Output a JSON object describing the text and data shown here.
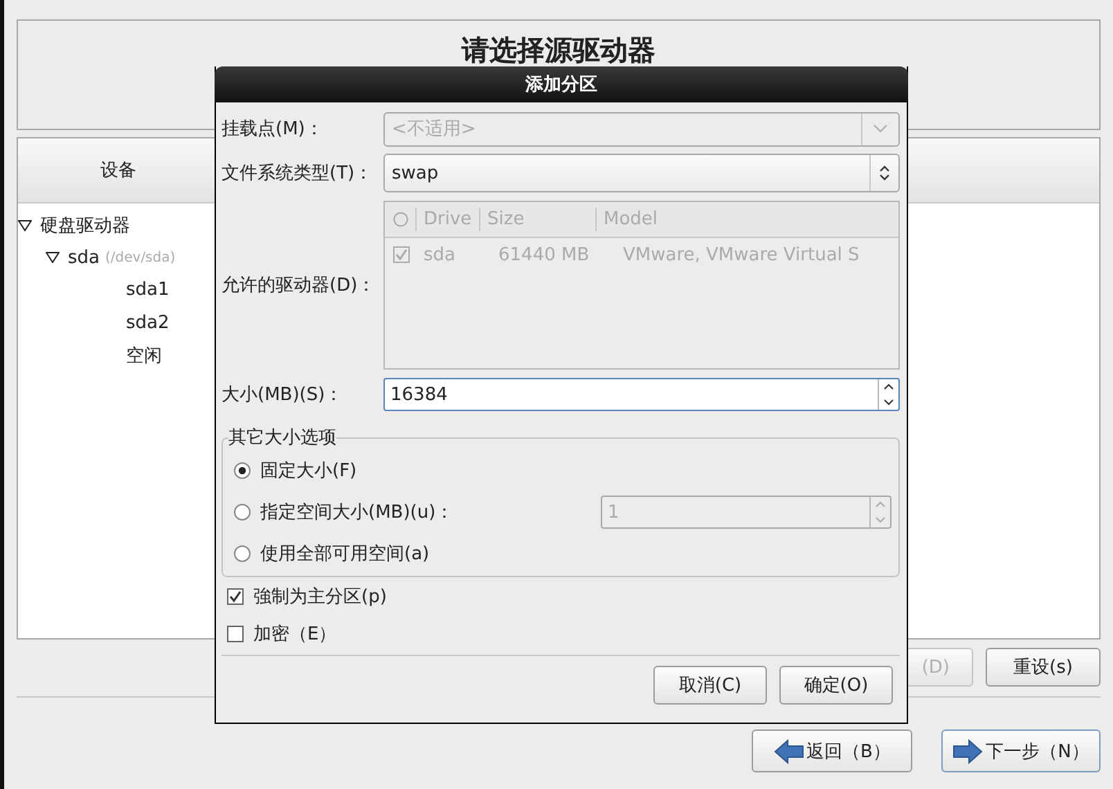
{
  "window": {
    "heading": "请选择源驱动器"
  },
  "device_panel": {
    "column": "设备",
    "tree": [
      {
        "label": "硬盘驱动器",
        "expanded": true,
        "children": [
          {
            "label": "sda",
            "detail": "(/dev/sda)",
            "expanded": true,
            "children": [
              {
                "label": "sda1"
              },
              {
                "label": "sda2"
              },
              {
                "label": "空闲"
              }
            ]
          }
        ]
      }
    ]
  },
  "panel_buttons": [
    {
      "label": "(D)",
      "disabled": true
    },
    {
      "label": "重设(s)",
      "disabled": false
    }
  ],
  "nav_buttons": [
    {
      "label": "返回（B）",
      "kind": "back"
    },
    {
      "label": "下一步（N）",
      "kind": "next"
    }
  ],
  "dialog": {
    "title": "添加分区",
    "mount_point": {
      "label": "挂载点(M)：",
      "value": "<不适用>",
      "disabled": true
    },
    "fs_type": {
      "label": "文件系统类型(T)：",
      "value": "swap"
    },
    "drives": {
      "label": "允许的驱动器(D)：",
      "disabled": true,
      "columns": [
        "Drive",
        "Size",
        "Model"
      ],
      "rows": [
        {
          "checked": true,
          "cells": [
            "sda",
            "61440 MB",
            "VMware, VMware Virtual S"
          ]
        }
      ]
    },
    "size": {
      "label": "大小(MB)(S)：",
      "value": "16384"
    },
    "size_options": {
      "legend": "其它大小选项",
      "options": [
        {
          "label": "固定大小(F)",
          "selected": true
        },
        {
          "label": "指定空间大小(MB)(u)：",
          "selected": false,
          "spin": {
            "value": "1",
            "disabled": true
          }
        },
        {
          "label": "使用全部可用空间(a)",
          "selected": false
        }
      ]
    },
    "checks": [
      {
        "label": "強制为主分区(p)",
        "checked": true
      },
      {
        "label": "加密（E）",
        "checked": false
      }
    ],
    "buttons": [
      "取消(C)",
      "确定(O)"
    ]
  }
}
